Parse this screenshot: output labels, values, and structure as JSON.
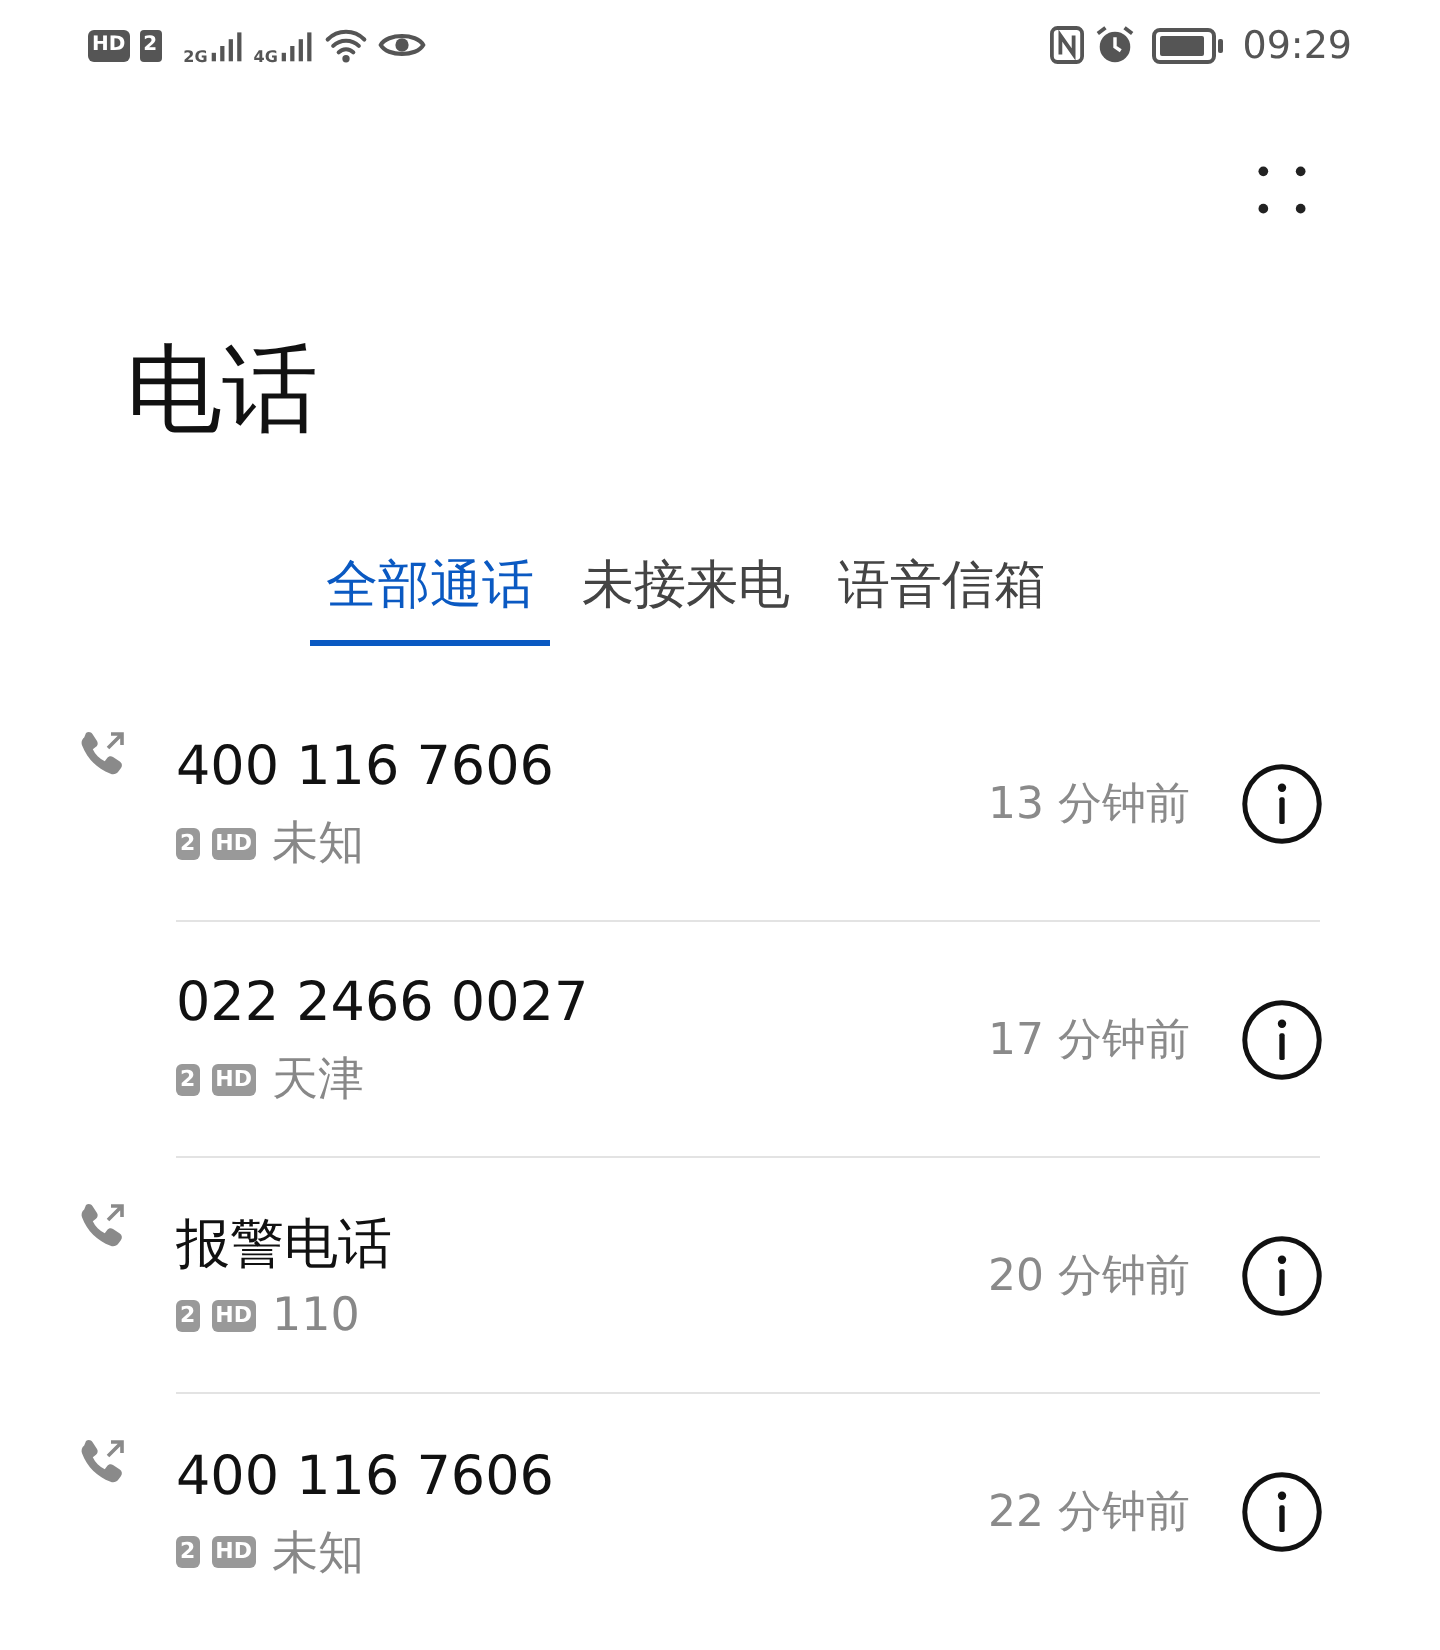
{
  "status_bar": {
    "hd": "HD",
    "sim": "2",
    "net1": "2G",
    "net2": "4G",
    "time": "09:29"
  },
  "title": "电话",
  "tabs": [
    {
      "label": "全部通话",
      "selected": true
    },
    {
      "label": "未接来电",
      "selected": false
    },
    {
      "label": "语音信箱",
      "selected": false
    }
  ],
  "calls": [
    {
      "name": "400 116 7606",
      "outgoing": true,
      "sim": "2",
      "hd": "HD",
      "location": "未知",
      "time": "13 分钟前"
    },
    {
      "name": "022 2466 0027",
      "outgoing": false,
      "sim": "2",
      "hd": "HD",
      "location": "天津",
      "time": "17 分钟前"
    },
    {
      "name": "报警电话",
      "outgoing": true,
      "sim": "2",
      "hd": "HD",
      "location": "110",
      "time": "20 分钟前"
    },
    {
      "name": "400 116 7606",
      "outgoing": true,
      "sim": "2",
      "hd": "HD",
      "location": "未知",
      "time": "22 分钟前"
    }
  ]
}
